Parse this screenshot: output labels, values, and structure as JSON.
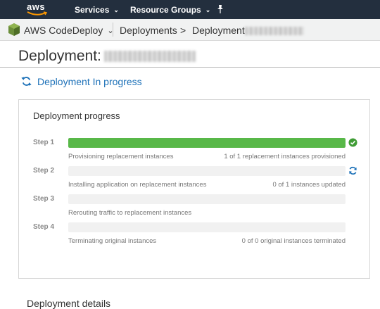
{
  "topnav": {
    "logo_text": "aws",
    "services_label": "Services",
    "resource_groups_label": "Resource Groups"
  },
  "breadcrumb": {
    "service_label": "AWS CodeDeploy",
    "deployments_label": "Deployments",
    "separator": ">",
    "current_label": "Deployment"
  },
  "page": {
    "title": "Deployment:"
  },
  "status": {
    "text": "Deployment In progress"
  },
  "progress": {
    "title": "Deployment progress",
    "steps": [
      {
        "label": "Step 1",
        "description": "Provisioning replacement instances",
        "count": "1 of 1 replacement instances provisioned",
        "progress": 1.0,
        "state": "complete"
      },
      {
        "label": "Step 2",
        "description": "Installing application on replacement instances",
        "count": "0 of 1 instances updated",
        "progress": 0.0,
        "state": "in-progress"
      },
      {
        "label": "Step 3",
        "description": "Rerouting traffic to replacement instances",
        "count": "",
        "progress": 0.0,
        "state": "pending"
      },
      {
        "label": "Step 4",
        "description": "Terminating original instances",
        "count": "0 of 0 original instances terminated",
        "progress": 0.0,
        "state": "pending"
      }
    ]
  },
  "details": {
    "heading": "Deployment details"
  },
  "colors": {
    "nav_bg": "#232f3e",
    "accent_blue": "#1d71b8",
    "success_green": "#58b848"
  }
}
